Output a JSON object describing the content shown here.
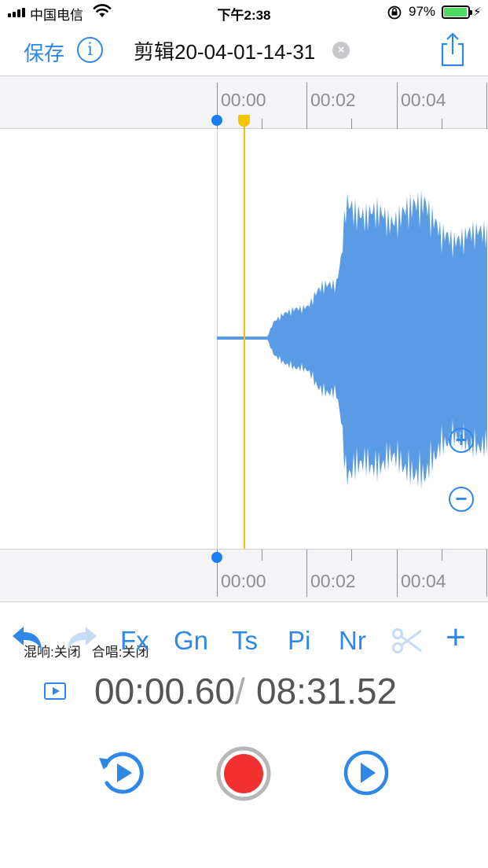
{
  "status_bar": {
    "carrier": "中国电信",
    "time": "下午2:38",
    "battery_percent": "97%",
    "battery_level": 0.97
  },
  "nav": {
    "save_label": "保存",
    "info_label": "i",
    "title": "剪辑20-04-01-14-31",
    "clear_label": "×"
  },
  "timeline": {
    "top_labels": [
      "00:00",
      "00:02",
      "00:04"
    ],
    "bottom_labels": [
      "00:00",
      "00:02",
      "00:04"
    ]
  },
  "effects_status": {
    "reverb": "混响:关闭",
    "chorus": "合唱:关闭"
  },
  "zoom": {
    "in_label": "+",
    "out_label": "−"
  },
  "toolbar": {
    "undo_icon": "undo-icon",
    "redo_icon": "redo-icon",
    "fx_label": "Fx",
    "gn_label": "Gn",
    "ts_label": "Ts",
    "pi_label": "Pi",
    "nr_label": "Nr",
    "scissors_icon": "scissors-icon",
    "add_label": "+"
  },
  "playback": {
    "current_time": "00:00.60",
    "separator": "/",
    "total_time": "08:31.52"
  },
  "colors": {
    "accent": "#2f88e8",
    "waveform": "#5a9be6",
    "playhead": "#f2c200",
    "record": "#f23030"
  }
}
